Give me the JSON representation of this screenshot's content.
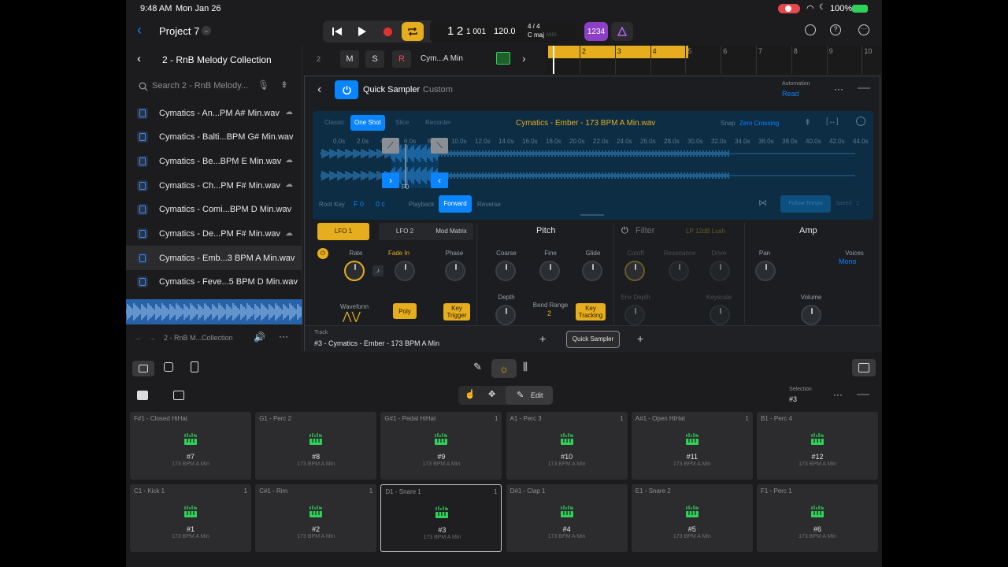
{
  "status": {
    "time": "9:48 AM",
    "date": "Mon Jan 26",
    "battery": "100%"
  },
  "topbar": {
    "back_label": "<",
    "project": "Project 7",
    "bar": "1",
    "beat": "2",
    "division": "1 001",
    "tempo": "120.0",
    "signature": "4 / 4",
    "key": "C maj",
    "midi": "MIDI",
    "count_in": "1234"
  },
  "browser": {
    "title": "2 - RnB Melody Collection",
    "search_placeholder": "Search 2 - RnB Melody...",
    "files": [
      "Cymatics - An...PM A# Min.wav",
      "Cymatics - Balti...BPM G# Min.wav",
      "Cymatics - Be...BPM E Min.wav",
      "Cymatics - Ch...PM F# Min.wav",
      "Cymatics - Comi...BPM D Min.wav",
      "Cymatics - De...PM F# Min.wav",
      "Cymatics - Emb...3 BPM A Min.wav",
      "Cymatics - Feve...5 BPM D Min.wav"
    ],
    "footer_path_1": "...",
    "footer_path_2": "...",
    "footer_path": "2 - RnB M...Collection"
  },
  "track": {
    "number": "2",
    "mute": "M",
    "solo": "S",
    "record": "R",
    "name": "Cym...A Min",
    "ruler": [
      "2",
      "3",
      "4",
      "5",
      "6",
      "7",
      "8",
      "9",
      "10"
    ]
  },
  "plugin": {
    "name": "Quick Sampler",
    "preset": "Custom",
    "automation_label": "Automation",
    "automation_value": "Read",
    "modes": [
      "Classic",
      "One Shot",
      "Slice",
      "Recorder"
    ],
    "file": "Cymatics - Ember - 173 BPM A Min.wav",
    "snap_label": "Snap",
    "snap_value": "Zero Crossing",
    "time_ticks": [
      "0.0s",
      "2.0s",
      "4.0s",
      "6.0s",
      "8.0s",
      "10.0s",
      "12.0s",
      "14.0s",
      "16.0s",
      "18.0s",
      "20.0s",
      "22.0s",
      "24.0s",
      "26.0s",
      "28.0s",
      "30.0s",
      "32.0s",
      "34.0s",
      "36.0s",
      "38.0s",
      "40.0s",
      "42.0s",
      "44.0s"
    ],
    "root_key_label": "Root Key",
    "root_key": "F 0",
    "fine": "0 c",
    "marker": "F0",
    "playback_label": "Playback",
    "forward": "Forward",
    "reverse": "Reverse",
    "flex_label": "Follow Tempo",
    "speed_label": "Speed",
    "speed_value": "1",
    "lfo_tabs": [
      "LFO 1",
      "LFO 2",
      "Mod Matrix"
    ],
    "rate": "Rate",
    "fade_in": "Fade In",
    "phase": "Phase",
    "waveform": "Waveform",
    "poly": "Poly",
    "key_trigger": "Key Trigger",
    "pitch_title": "Pitch",
    "coarse": "Coarse",
    "fine_knob": "Fine",
    "glide": "Glide",
    "depth": "Depth",
    "bend_range": "Bend Range",
    "bend_value": "2",
    "key_tracking": "Key Tracking",
    "filter_title": "Filter",
    "filter_type": "LP 12dB Lush",
    "cutoff": "Cutoff",
    "resonance": "Resonance",
    "drive": "Drive",
    "env_depth": "Env Depth",
    "keyscale": "Keyscale",
    "amp_title": "Amp",
    "pan": "Pan",
    "voices": "Voices",
    "voices_value": "Mono",
    "volume": "Volume",
    "track_label": "Track",
    "track_name": "#3 - Cymatics - Ember - 173 BPM A Min",
    "plugin_slot": "Quick Sampler"
  },
  "pads_bar": {
    "edit_label": "Edit",
    "selection_label": "Selection",
    "selection_value": "#3"
  },
  "pads": [
    {
      "name": "F#1 - Closed HiHat",
      "count": "",
      "num": "#7",
      "sub": "173 BPM A Min"
    },
    {
      "name": "G1 - Perc 2",
      "count": "",
      "num": "#8",
      "sub": "173 BPM A Min"
    },
    {
      "name": "G#1 - Pedal HiHat",
      "count": "1",
      "num": "#9",
      "sub": "173 BPM A Min"
    },
    {
      "name": "A1 - Perc 3",
      "count": "1",
      "num": "#10",
      "sub": "173 BPM A Min"
    },
    {
      "name": "A#1 - Open HiHat",
      "count": "1",
      "num": "#11",
      "sub": "173 BPM A Min"
    },
    {
      "name": "B1 - Perc 4",
      "count": "",
      "num": "#12",
      "sub": "173 BPM A Min"
    },
    {
      "name": "C1 - Kick 1",
      "count": "1",
      "num": "#1",
      "sub": "173 BPM A Min"
    },
    {
      "name": "C#1 - Rim",
      "count": "1",
      "num": "#2",
      "sub": "173 BPM A Min"
    },
    {
      "name": "D1 - Snare 1",
      "count": "1",
      "num": "#3",
      "sub": "173 BPM A Min"
    },
    {
      "name": "D#1 - Clap 1",
      "count": "",
      "num": "#4",
      "sub": "173 BPM A Min"
    },
    {
      "name": "E1 - Snare 2",
      "count": "",
      "num": "#5",
      "sub": "173 BPM A Min"
    },
    {
      "name": "F1 - Perc 1",
      "count": "",
      "num": "#6",
      "sub": "173 BPM A Min"
    }
  ],
  "colors": {
    "accent": "#0a84ff",
    "yellow": "#e6ad1e",
    "green": "#30d158",
    "sampler_bg": "#0c2d44",
    "purple": "#8e3fc8"
  }
}
